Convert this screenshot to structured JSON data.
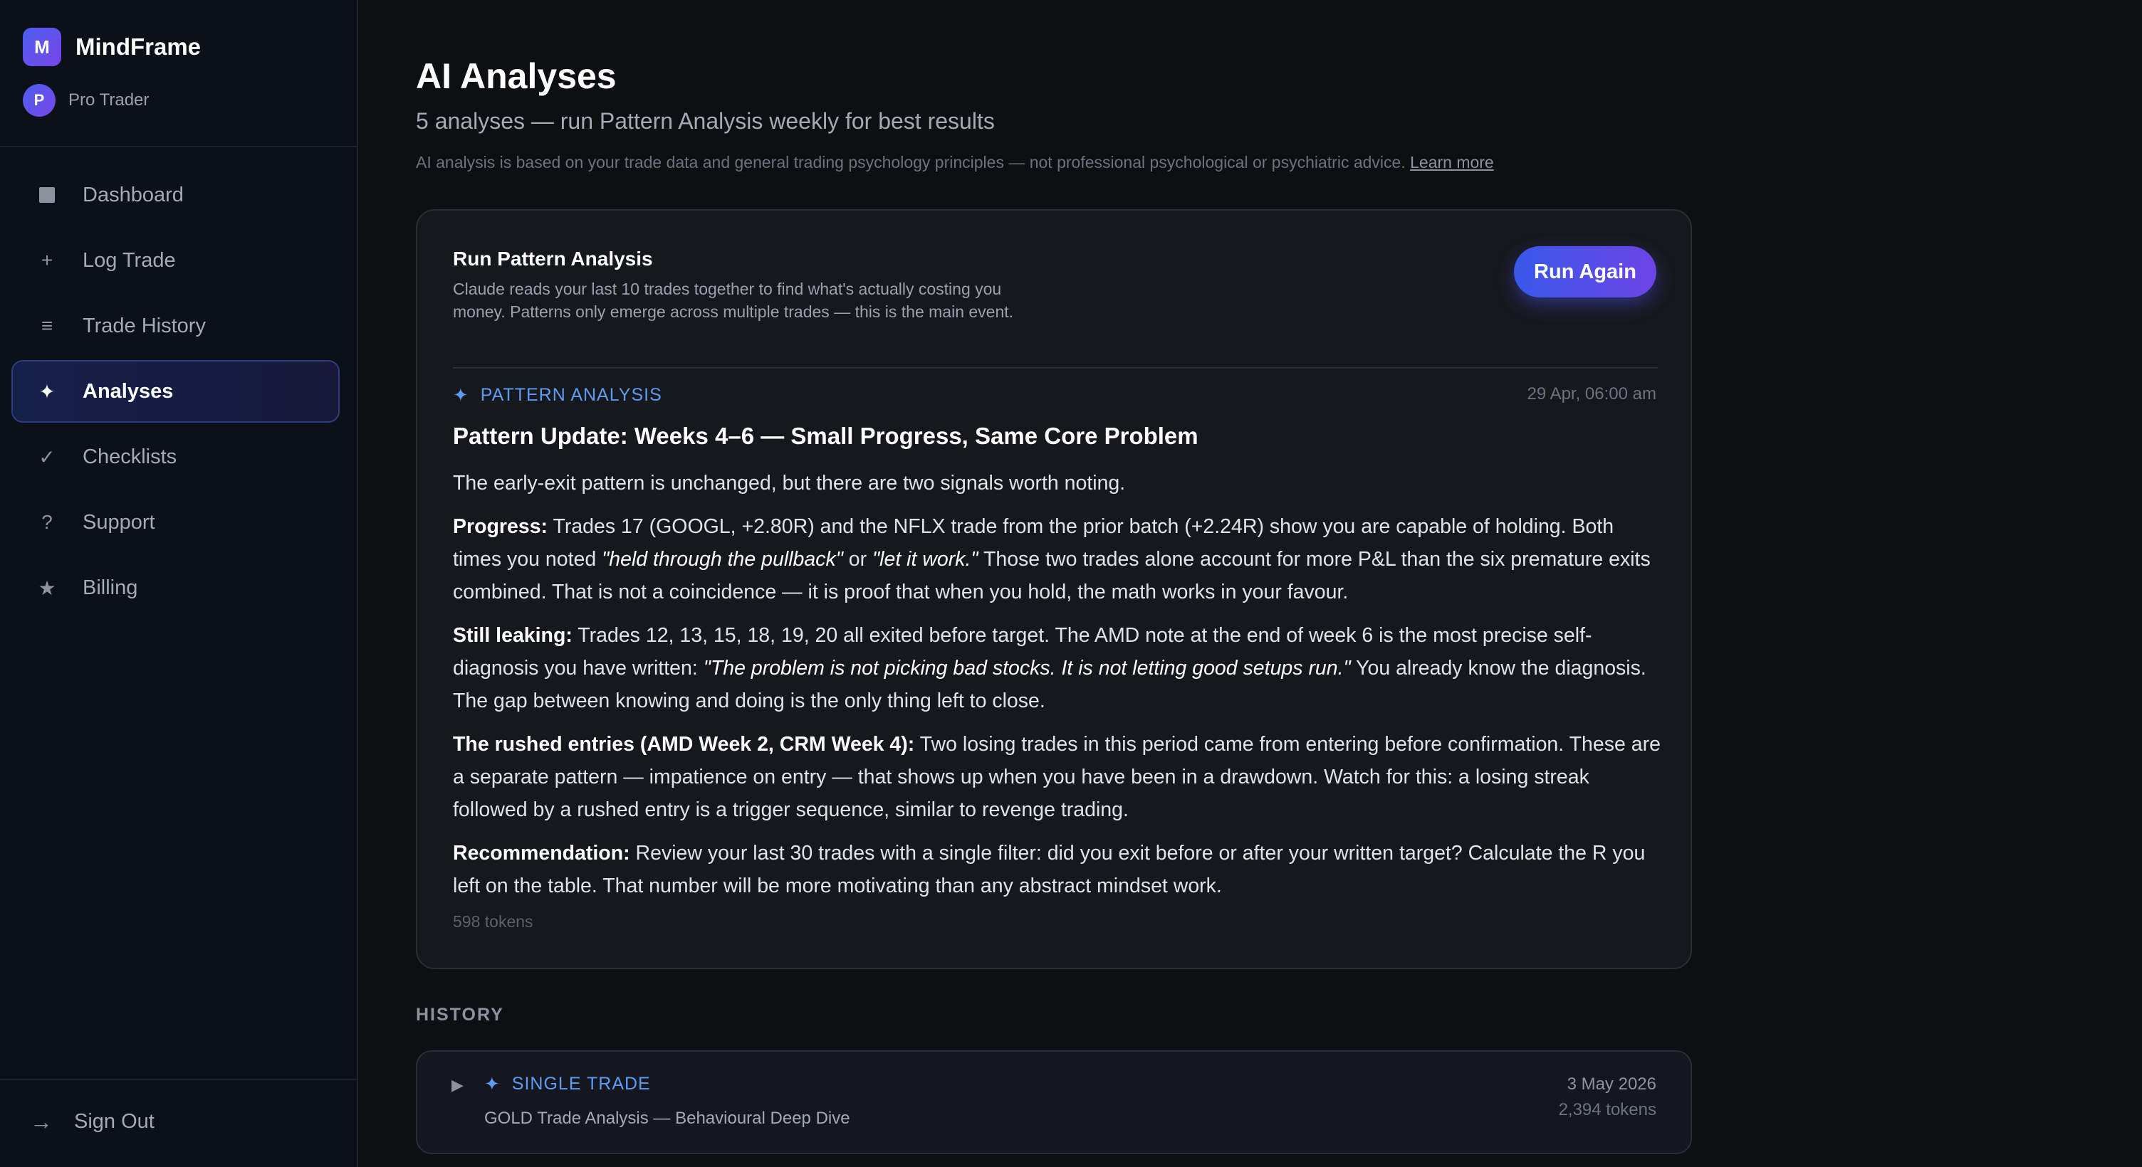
{
  "app": {
    "brand_initial": "M",
    "brand_name": "MindFrame",
    "user_initial": "P",
    "user_plan": "Pro Trader"
  },
  "nav": {
    "items": [
      {
        "label": "Dashboard",
        "icon": "dashboard-square-icon"
      },
      {
        "label": "Log Trade",
        "icon": "plus-icon",
        "glyph": "+"
      },
      {
        "label": "Trade History",
        "icon": "list-icon",
        "glyph": "≡"
      },
      {
        "label": "Analyses",
        "icon": "sparkle-icon",
        "glyph": "✦",
        "active": true
      },
      {
        "label": "Checklists",
        "icon": "checkmark-icon",
        "glyph": "✓"
      },
      {
        "label": "Support",
        "icon": "question-icon",
        "glyph": "?"
      },
      {
        "label": "Billing",
        "icon": "star-icon",
        "glyph": "★"
      }
    ],
    "sign_out": {
      "label": "Sign Out",
      "icon": "arrow-right-icon",
      "glyph": "→"
    }
  },
  "page": {
    "title": "AI Analyses",
    "subtitle": "5 analyses — run Pattern Analysis weekly for best results",
    "disclaimer": "AI analysis is based on your trade data and general trading psychology principles — not professional psychological or psychiatric advice.",
    "learn_more": "Learn more"
  },
  "run_card": {
    "title": "Run Pattern Analysis",
    "description": "Claude reads your last 10 trades together to find what's actually costing you money. Patterns only emerge across multiple trades — this is the main event.",
    "button_label": "Run Again"
  },
  "analysis": {
    "tag": "PATTERN ANALYSIS",
    "tag_glyph": "✦",
    "date": "29 Apr, 06:00 am",
    "title": "Pattern Update: Weeks 4–6 — Small Progress, Same Core Problem",
    "intro": "The early-exit pattern is unchanged, but there are two signals worth noting.",
    "progress": {
      "label": "Progress:",
      "text1": " Trades 17 (GOOGL, +2.80R) and the NFLX trade from the prior batch (+2.24R) show you are capable of holding. Both times you noted ",
      "quote1": "\"held through the pullback\"",
      "text2": " or ",
      "quote2": "\"let it work.\"",
      "text3": " Those two trades alone account for more P&L than the six premature exits combined. That is not a coincidence — it is proof that when you hold, the math works in your favour."
    },
    "leaking": {
      "label": "Still leaking:",
      "text1": " Trades 12, 13, 15, 18, 19, 20 all exited before target. The AMD note at the end of week 6 is the most precise self-diagnosis you have written: ",
      "quote": "\"The problem is not picking bad stocks. It is not letting good setups run.\"",
      "text2": " You already know the diagnosis. The gap between knowing and doing is the only thing left to close."
    },
    "rushed": {
      "label": "The rushed entries (AMD Week 2, CRM Week 4):",
      "text": " Two losing trades in this period came from entering before confirmation. These are a separate pattern — impatience on entry — that shows up when you have been in a drawdown. Watch for this: a losing streak followed by a rushed entry is a trigger sequence, similar to revenge trading."
    },
    "recommendation": {
      "label": "Recommendation:",
      "text": " Review your last 30 trades with a single filter: did you exit before or after your written target? Calculate the R you left on the table. That number will be more motivating than any abstract mindset work."
    },
    "tokens": "598 tokens"
  },
  "history": {
    "label": "HISTORY",
    "items": [
      {
        "caret": "▶",
        "tag": "SINGLE TRADE",
        "tag_glyph": "✦",
        "title": "GOLD Trade Analysis — Behavioural Deep Dive",
        "date": "3 May 2026",
        "tokens": "2,394 tokens"
      }
    ]
  },
  "colors": {
    "accent": "#5d9cf5",
    "button_gradient_start": "#3858ea",
    "button_gradient_end": "#6e44e6",
    "background": "#0e0f13",
    "sidebar": "#0b1019",
    "card": "#17181d"
  }
}
